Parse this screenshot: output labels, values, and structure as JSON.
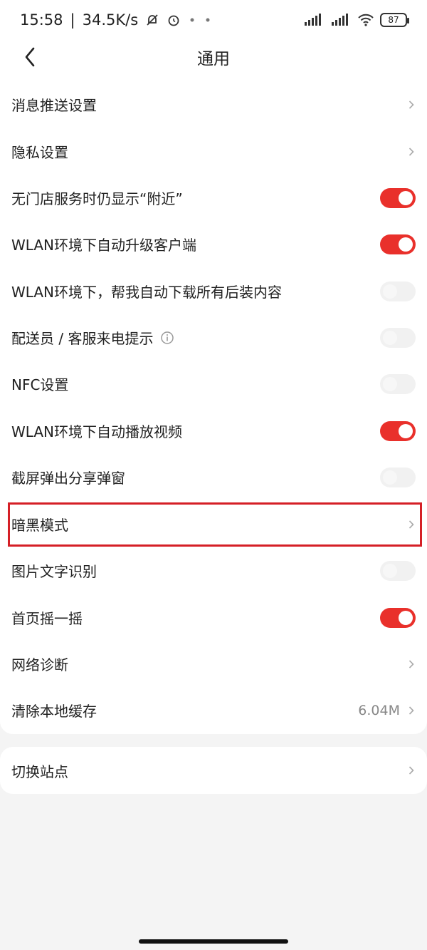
{
  "status_bar": {
    "time": "15:58",
    "speed": "34.5K/s",
    "battery": "87",
    "icons": [
      "bell-off-icon",
      "alarm-icon",
      "signal-icon",
      "signal-icon",
      "wifi-icon",
      "battery-icon"
    ]
  },
  "header": {
    "title": "通用",
    "back_icon": "chevron-left-icon"
  },
  "settings": [
    {
      "label": "消息推送设置",
      "type": "link"
    },
    {
      "label": "隐私设置",
      "type": "link"
    },
    {
      "label": "无门店服务时仍显示“附近”",
      "type": "toggle",
      "on": true
    },
    {
      "label": "WLAN环境下自动升级客户端",
      "type": "toggle",
      "on": true
    },
    {
      "label": "WLAN环境下，帮我自动下载所有后装内容",
      "type": "toggle",
      "on": false
    },
    {
      "label": "配送员 / 客服来电提示",
      "type": "toggle",
      "on": false,
      "info_icon": true
    },
    {
      "label": "NFC设置",
      "type": "toggle",
      "on": false
    },
    {
      "label": "WLAN环境下自动播放视频",
      "type": "toggle",
      "on": true
    },
    {
      "label": "截屏弹出分享弹窗",
      "type": "toggle",
      "on": false
    },
    {
      "label": "暗黑模式",
      "type": "link",
      "highlighted": true
    },
    {
      "label": "图片文字识别",
      "type": "toggle",
      "on": false
    },
    {
      "label": "首页摇一摇",
      "type": "toggle",
      "on": true
    },
    {
      "label": "网络诊断",
      "type": "link"
    },
    {
      "label": "清除本地缓存",
      "type": "link",
      "value": "6.04M"
    }
  ],
  "second_section": {
    "label": "切换站点",
    "type": "link"
  },
  "colors": {
    "accent": "#e9302b",
    "highlight_border": "#d51f26",
    "background": "#f4f4f4",
    "card": "#ffffff"
  }
}
